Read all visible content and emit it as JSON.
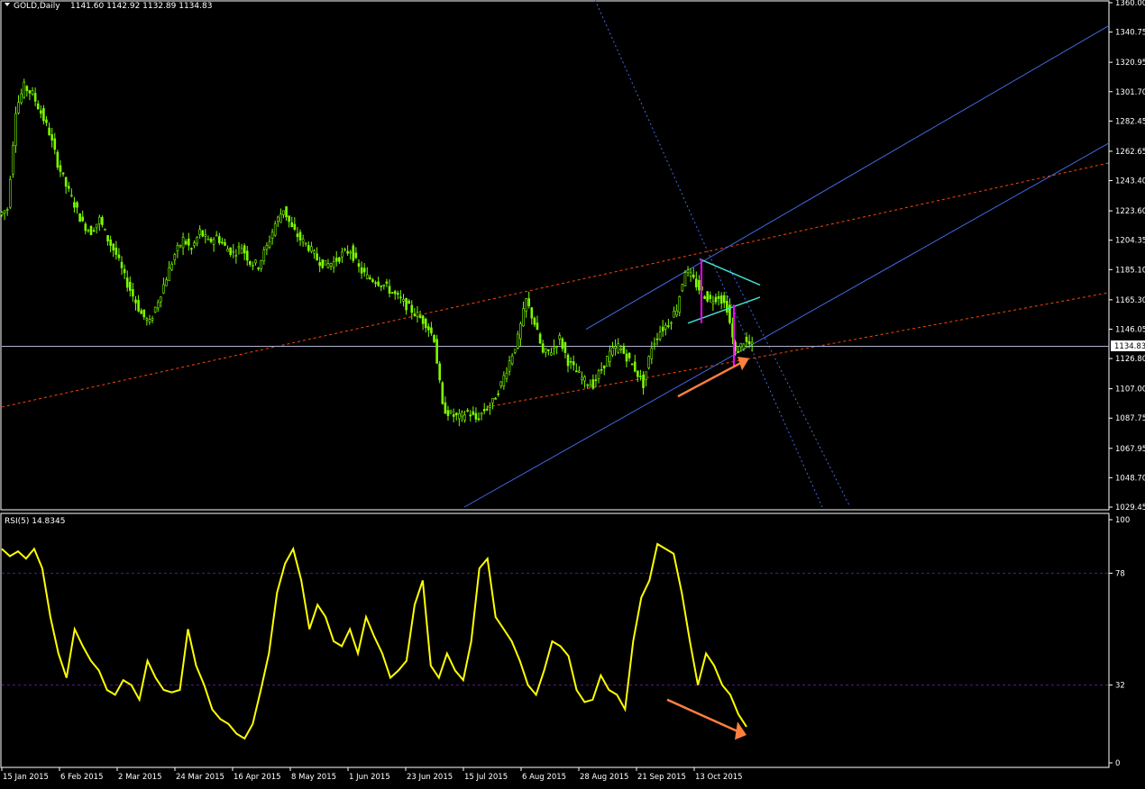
{
  "window": {
    "symbol_label": "GOLD,Daily",
    "ohlc_label": "1141.60 1142.92 1132.89 1134.83",
    "rsi_label": "RSI(5) 14.8345"
  },
  "colors": {
    "background": "#000000",
    "bull_candle": "#7cfc00",
    "rsi_line": "#ffff00",
    "channel_line": "#4169e1",
    "trend_dash": "#ff4500",
    "triangle": "#40e0d0",
    "flag_pole": "#ff00ff",
    "arrow": "#ff7f3f",
    "level_line": "#ffffff",
    "rsi_levels": "#5a1a8a"
  },
  "chart_data": [
    {
      "type": "candlestick",
      "title": "GOLD,Daily",
      "ylim": [
        1029.45,
        1360.0
      ],
      "y_ticks": [
        "1360.00",
        "1340.75",
        "1320.95",
        "1301.70",
        "1282.45",
        "1262.65",
        "1243.40",
        "1223.60",
        "1204.35",
        "1185.10",
        "1165.30",
        "1146.05",
        "1126.80",
        "1107.00",
        "1087.75",
        "1067.95",
        "1048.70",
        "1029.45"
      ],
      "current_price_label": "1134.83",
      "x_ticks": [
        "15 Jan 2015",
        "6 Feb 2015",
        "2 Mar 2015",
        "24 Mar 2015",
        "16 Apr 2015",
        "8 May 2015",
        "1 Jun 2015",
        "23 Jun 2015",
        "15 Jul 2015",
        "6 Aug 2015",
        "28 Aug 2015",
        "21 Sep 2015",
        "13 Oct 2015"
      ],
      "close_path": [
        1225,
        1290,
        1305,
        1300,
        1288,
        1275,
        1255,
        1240,
        1228,
        1215,
        1210,
        1218,
        1205,
        1195,
        1180,
        1168,
        1156,
        1150,
        1165,
        1180,
        1195,
        1205,
        1198,
        1210,
        1203,
        1207,
        1200,
        1196,
        1200,
        1190,
        1188,
        1200,
        1215,
        1225,
        1212,
        1205,
        1200,
        1192,
        1188,
        1190,
        1195,
        1198,
        1186,
        1180,
        1178,
        1175,
        1170,
        1165,
        1160,
        1155,
        1150,
        1140,
        1095,
        1090,
        1088,
        1092,
        1087,
        1093,
        1098,
        1110,
        1125,
        1140,
        1165,
        1150,
        1130,
        1132,
        1140,
        1125,
        1118,
        1112,
        1110,
        1120,
        1130,
        1135,
        1128,
        1120,
        1110,
        1135,
        1145,
        1150,
        1160,
        1185,
        1178,
        1170,
        1165,
        1168,
        1160,
        1130,
        1138,
        1134.83
      ],
      "annotations": {
        "horizontal_level": 1134.83,
        "rising_channel": "blue",
        "dashed_trendlines": "orange-red",
        "triangle": "cyan",
        "flag_poles": "magenta",
        "arrow": "up"
      }
    },
    {
      "type": "line",
      "title": "RSI(5) 14.8345",
      "ylim": [
        0,
        100
      ],
      "y_ticks": [
        "100",
        "78",
        "32",
        "0"
      ],
      "levels": [
        78,
        32
      ],
      "values": [
        88,
        85,
        87,
        84,
        88,
        80,
        60,
        45,
        35,
        55,
        48,
        42,
        38,
        30,
        28,
        34,
        32,
        26,
        42,
        35,
        30,
        29,
        30,
        55,
        40,
        32,
        22,
        18,
        16,
        12,
        10,
        16,
        30,
        45,
        70,
        82,
        88,
        75,
        55,
        65,
        60,
        50,
        48,
        55,
        45,
        60,
        52,
        45,
        35,
        38,
        42,
        65,
        75,
        40,
        35,
        45,
        38,
        34,
        50,
        80,
        84,
        60,
        55,
        50,
        42,
        32,
        28,
        38,
        50,
        48,
        44,
        30,
        25,
        26,
        36,
        30,
        28,
        22,
        50,
        68,
        75,
        90,
        88,
        86,
        70,
        50,
        32,
        45,
        40,
        32,
        28,
        20,
        14.8345
      ],
      "annotations": {
        "arrow": "down"
      }
    }
  ]
}
